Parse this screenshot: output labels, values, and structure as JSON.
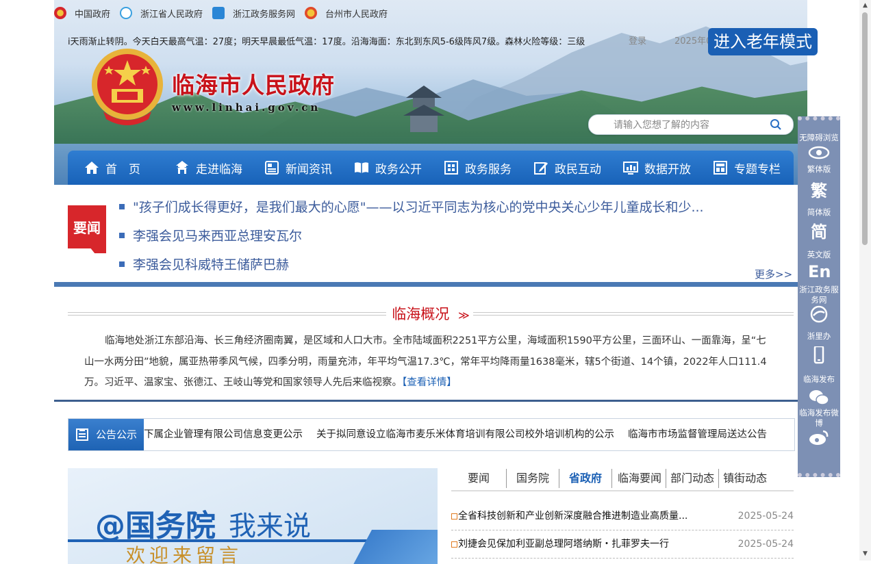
{
  "topnav": {
    "links": [
      {
        "label": "中国政府"
      },
      {
        "label": "浙江省人民政府"
      },
      {
        "label": "浙江政务服务网"
      },
      {
        "label": "台州市人民政府"
      }
    ]
  },
  "header": {
    "weather": "i天雨渐止转阴。今天白天最高气温：27度；明天早晨最低气温：17度。沿海海面：东北到东风5-6级阵风7级。森林火险等级：三级",
    "login": "登录",
    "date": "2025年0",
    "site_title": "临海市人民政府",
    "site_url": "www.linhai.gov.cn",
    "old_mode": "进入老年模式",
    "search_placeholder": "请输入您想了解的内容"
  },
  "mainnav": [
    {
      "label": "首　页",
      "icon": "home-icon"
    },
    {
      "label": "走进临海",
      "icon": "pavilion-icon"
    },
    {
      "label": "新闻资讯",
      "icon": "newspaper-icon"
    },
    {
      "label": "政务公开",
      "icon": "book-icon"
    },
    {
      "label": "政务服务",
      "icon": "service-icon"
    },
    {
      "label": "政民互动",
      "icon": "edit-icon"
    },
    {
      "label": "数据开放",
      "icon": "chart-icon"
    },
    {
      "label": "专题专栏",
      "icon": "column-icon"
    }
  ],
  "headlines": {
    "tag": "要闻",
    "items": [
      "\"孩子们成长得更好，是我们最大的心愿\"——以习近平同志为核心的党中央关心少年儿童成长和少...",
      "李强会见马来西亚总理安瓦尔",
      "李强会见科威特王储萨巴赫"
    ],
    "more": "更多>>"
  },
  "overview": {
    "title": "临海概况",
    "text": "临海地处浙江东部沿海、长三角经济圈南翼，是区域和人口大市。全市陆域面积2251平方公里，海域面积1590平方公里，三面环山、一面靠海，呈“七山一水两分田”地貌，属亚热带季风气候，四季分明，雨量充沛，年平均气温17.3℃，常年平均降雨量1638毫米，辖5个街道、14个镇，2022年人口111.4万。习近平、温家宝、张德江、王岐山等党和国家领导人先后来临视察。",
    "detail_link": "【查看详情】"
  },
  "notice": {
    "tag": "公告公示",
    "items": [
      "下属企业管理有限公司信息变更公示",
      "关于拟同意设立临海市麦乐米体育培训有限公司校外培训机构的公示",
      "临海市市场监督管理局送达公告"
    ]
  },
  "promo": {
    "line1": "@国务院",
    "line2": "我来说",
    "line3": "欢迎来留言"
  },
  "newstabs": {
    "tabs": [
      "要闻",
      "国务院",
      "省政府",
      "临海要闻",
      "部门动态",
      "镇街动态"
    ],
    "active": 2,
    "rows": [
      {
        "title": "全省科技创新和产业创新深度融合推进制造业高质量...",
        "date": "2025-05-24"
      },
      {
        "title": "刘捷会见保加利亚副总理阿塔纳斯・扎菲罗夫一行",
        "date": "2025-05-24"
      }
    ]
  },
  "sidebar": {
    "items": [
      {
        "label": "无障碍浏览",
        "glyph": "",
        "icon": "eye-icon"
      },
      {
        "label": "繁体版",
        "glyph": "繁",
        "icon": "traditional-icon"
      },
      {
        "label": "简体版",
        "glyph": "简",
        "icon": "simplified-icon"
      },
      {
        "label": "英文版",
        "glyph": "En",
        "icon": "english-icon"
      },
      {
        "label": "浙江政务服务网",
        "glyph": "",
        "icon": "zjzw-icon"
      },
      {
        "label": "浙里办",
        "glyph": "",
        "icon": "mobile-icon"
      },
      {
        "label": "临海发布",
        "glyph": "",
        "icon": "wechat-icon"
      },
      {
        "label": "临海发布微博",
        "glyph": "",
        "icon": "weibo-icon"
      }
    ]
  },
  "colors": {
    "brand_red": "#c8121a",
    "nav_blue": "#1862b8",
    "link_blue": "#3b5b9b"
  }
}
